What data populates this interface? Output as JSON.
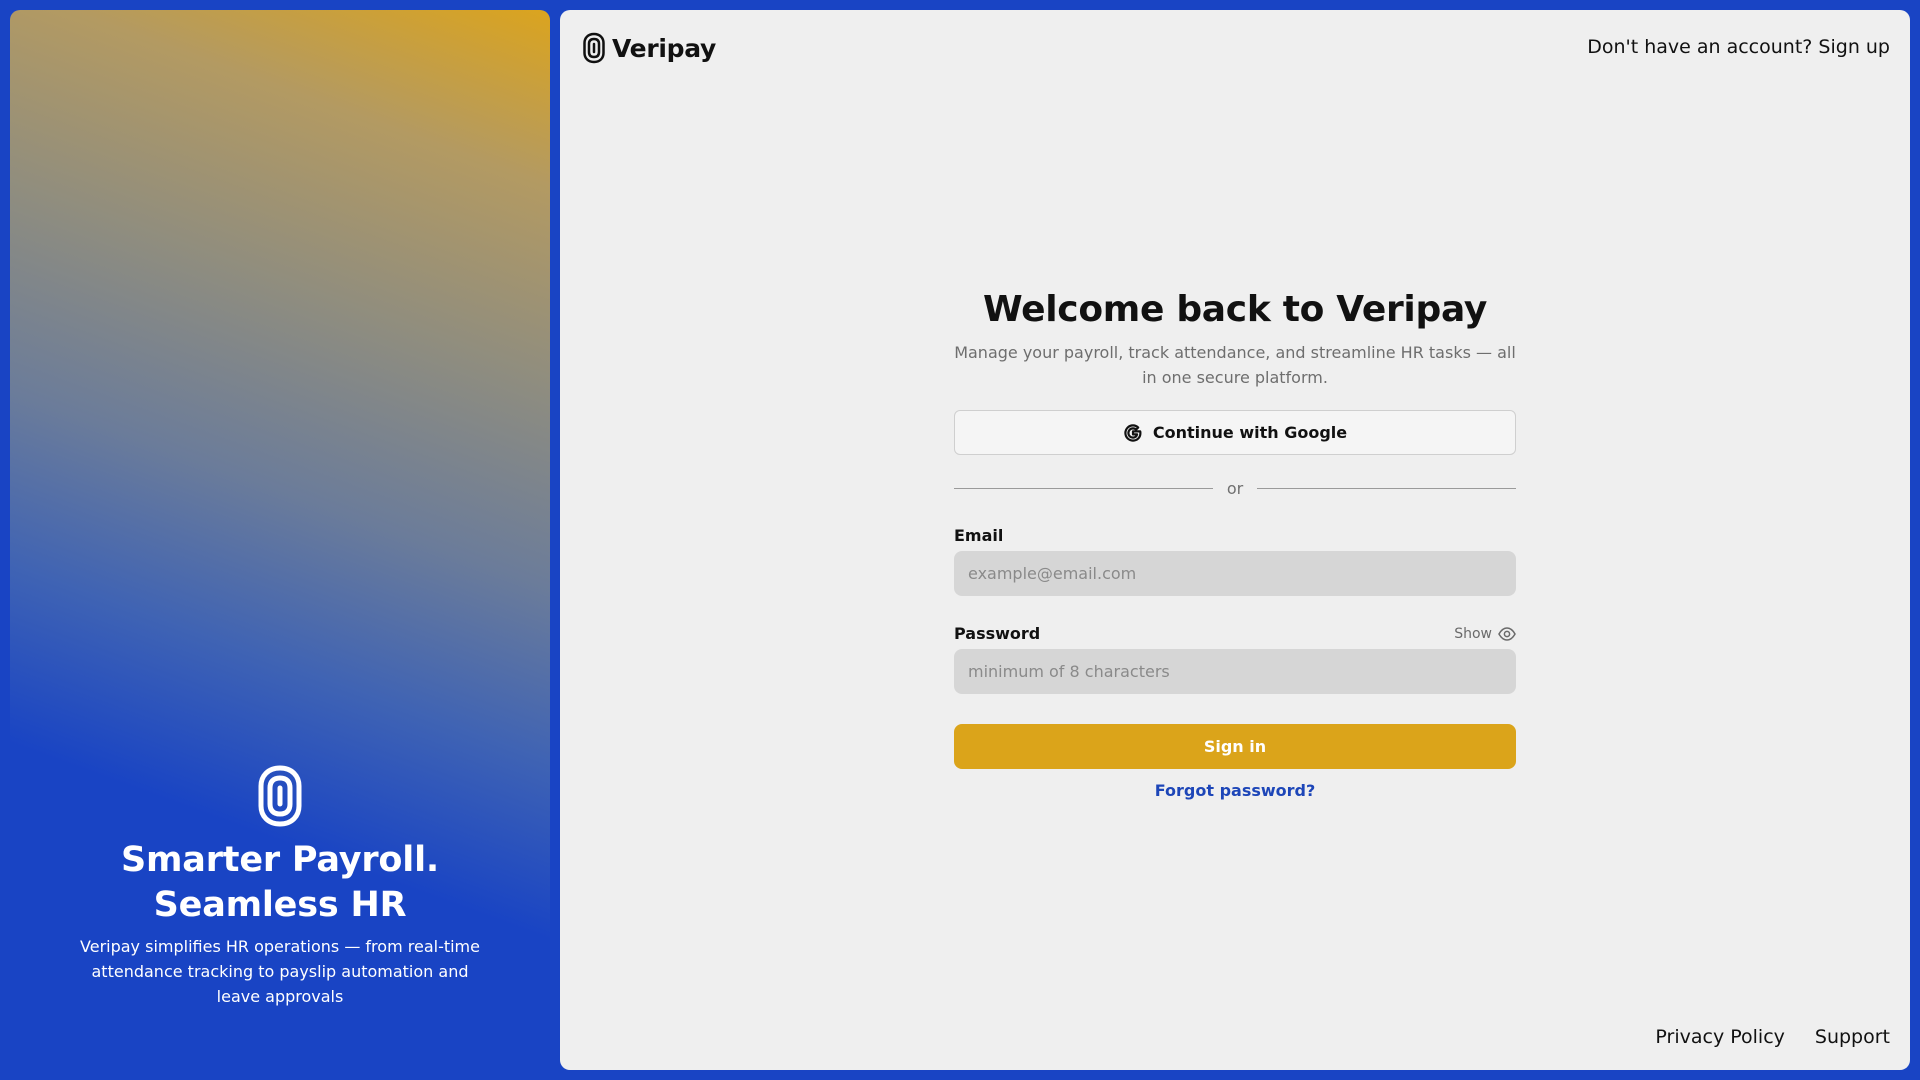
{
  "hero": {
    "logo_icon": "veripay-fingerprint-logo",
    "title": "Smarter Payroll. Seamless HR",
    "description": "Veripay simplifies HR operations — from real-time attendance tracking to payslip automation and leave approvals"
  },
  "header": {
    "brand_name": "Veripay",
    "logo_icon": "veripay-fingerprint-logo",
    "signup_text": "Don't have an account? Sign up"
  },
  "form": {
    "title": "Welcome back to Veripay",
    "subtitle": "Manage your payroll, track attendance, and streamline HR tasks — all in one secure platform.",
    "google_button": "Continue with Google",
    "google_icon": "google-g-icon",
    "divider_text": "or",
    "email": {
      "label": "Email",
      "placeholder": "example@email.com",
      "value": ""
    },
    "password": {
      "label": "Password",
      "show_label": "Show",
      "show_icon": "eye-icon",
      "placeholder": "minimum of 8 characters",
      "value": ""
    },
    "submit_label": "Sign in",
    "forgot_label": "Forgot password?"
  },
  "footer": {
    "privacy": "Privacy Policy",
    "support": "Support"
  },
  "colors": {
    "frame_blue": "#1944c4",
    "accent_gold": "#dba41a",
    "link_blue": "#1d46b8",
    "panel_bg": "#efefef",
    "input_bg": "#d6d6d6"
  }
}
